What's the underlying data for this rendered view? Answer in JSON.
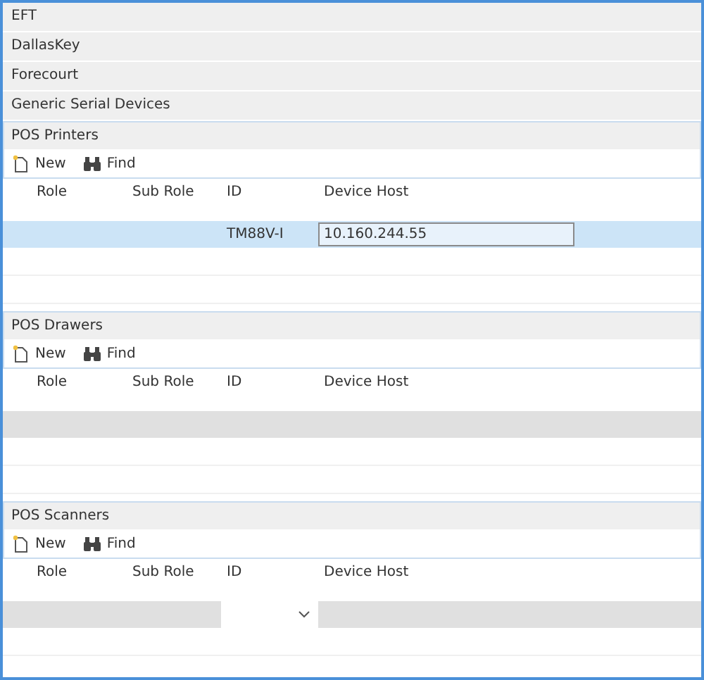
{
  "groups": [
    {
      "label": "EFT"
    },
    {
      "label": "DallasKey"
    },
    {
      "label": "Forecourt"
    },
    {
      "label": "Generic Serial Devices"
    }
  ],
  "sections": [
    {
      "title": "POS Printers",
      "toolbar": [
        "New",
        "Find"
      ],
      "columns": [
        "Role",
        "Sub Role",
        "ID",
        "Device Host"
      ],
      "rows": [
        {
          "kind": "entry",
          "selected": true,
          "id": "TM88V-I",
          "device_host": "10.160.244.55"
        }
      ]
    },
    {
      "title": "POS Drawers",
      "toolbar": [
        "New",
        "Find"
      ],
      "columns": [
        "Role",
        "Sub Role",
        "ID",
        "Device Host"
      ],
      "rows": [
        {
          "kind": "empty",
          "selected": false
        }
      ]
    },
    {
      "title": "POS Scanners",
      "toolbar": [
        "New",
        "Find"
      ],
      "columns": [
        "Role",
        "Sub Role",
        "ID",
        "Device Host"
      ],
      "rows": [
        {
          "kind": "id_dropdown",
          "selected": false
        }
      ]
    }
  ]
}
